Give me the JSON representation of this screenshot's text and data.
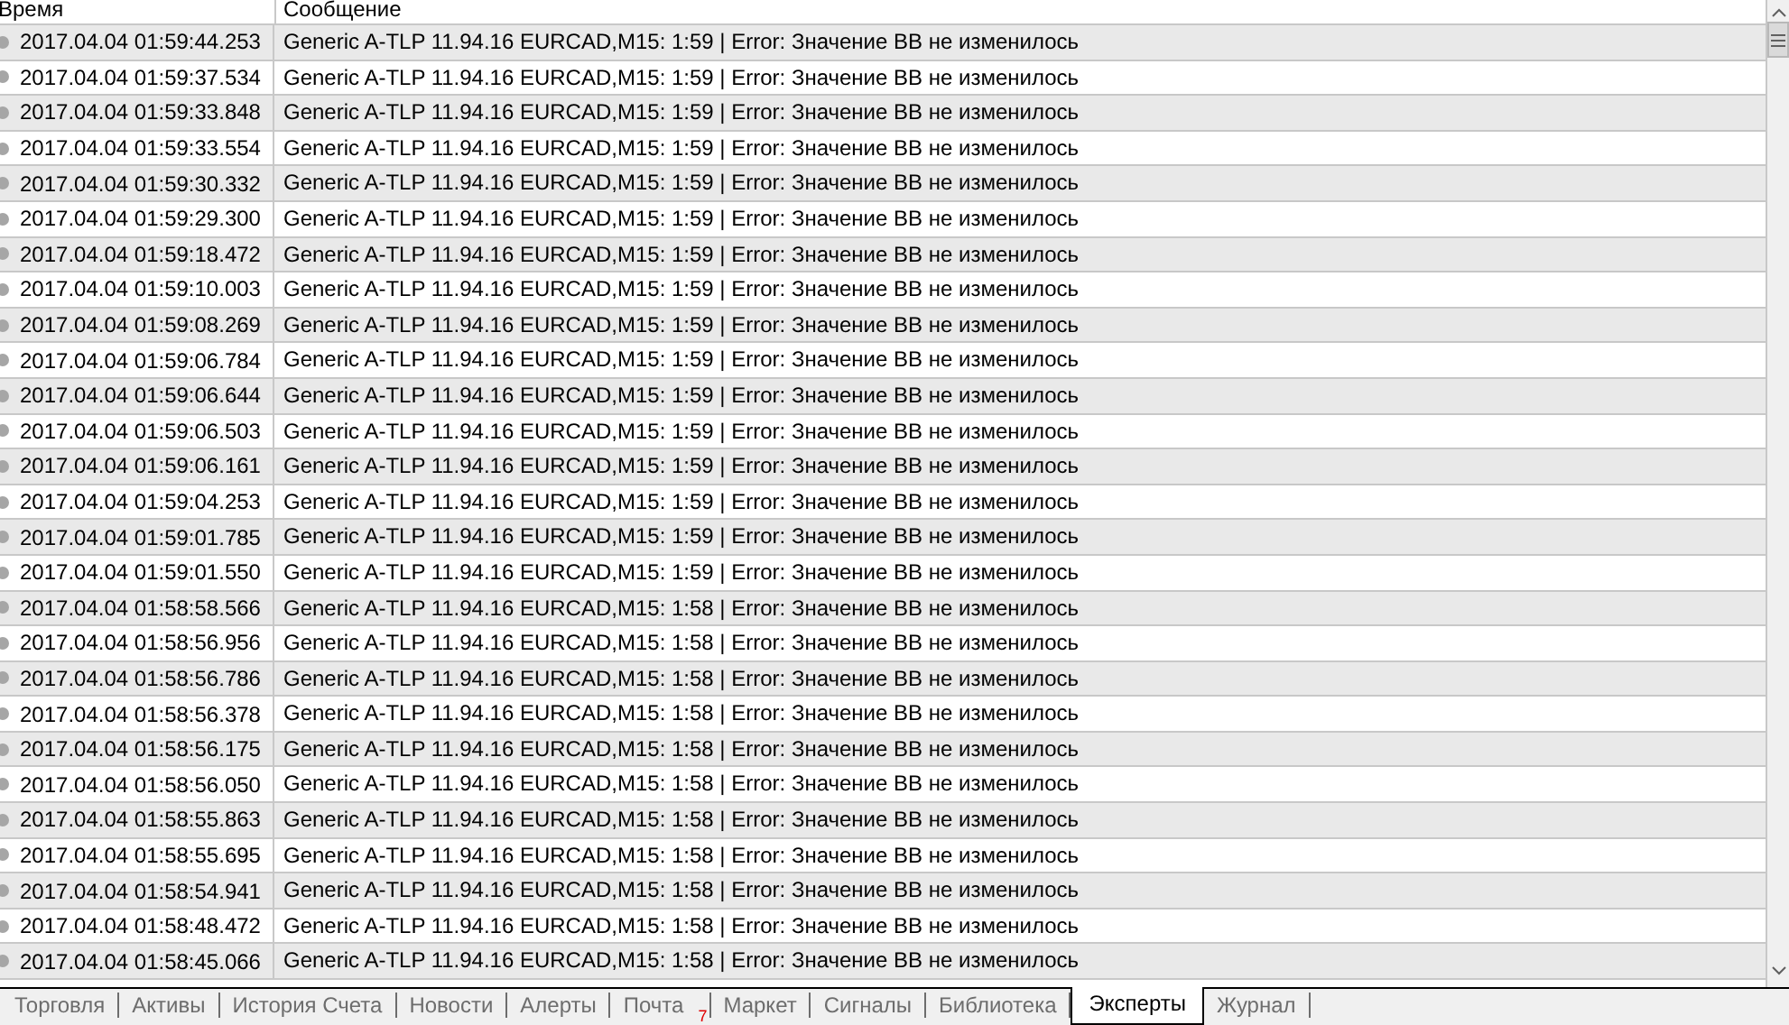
{
  "columns": [
    {
      "label": "Время"
    },
    {
      "label": "Сообщение"
    }
  ],
  "rows": [
    {
      "time": "2017.04.04 01:59:44.253",
      "message": "Generic A-TLP 11.94.16 EURCAD,M15: 1:59 | Error: Значение BB не изменилось"
    },
    {
      "time": "2017.04.04 01:59:37.534",
      "message": "Generic A-TLP 11.94.16 EURCAD,M15: 1:59 | Error: Значение BB не изменилось"
    },
    {
      "time": "2017.04.04 01:59:33.848",
      "message": "Generic A-TLP 11.94.16 EURCAD,M15: 1:59 | Error: Значение BB не изменилось"
    },
    {
      "time": "2017.04.04 01:59:33.554",
      "message": "Generic A-TLP 11.94.16 EURCAD,M15: 1:59 | Error: Значение BB не изменилось"
    },
    {
      "time": "2017.04.04 01:59:30.332",
      "message": "Generic A-TLP 11.94.16 EURCAD,M15: 1:59 | Error: Значение BB не изменилось"
    },
    {
      "time": "2017.04.04 01:59:29.300",
      "message": "Generic A-TLP 11.94.16 EURCAD,M15: 1:59 | Error: Значение BB не изменилось"
    },
    {
      "time": "2017.04.04 01:59:18.472",
      "message": "Generic A-TLP 11.94.16 EURCAD,M15: 1:59 | Error: Значение BB не изменилось"
    },
    {
      "time": "2017.04.04 01:59:10.003",
      "message": "Generic A-TLP 11.94.16 EURCAD,M15: 1:59 | Error: Значение BB не изменилось"
    },
    {
      "time": "2017.04.04 01:59:08.269",
      "message": "Generic A-TLP 11.94.16 EURCAD,M15: 1:59 | Error: Значение BB не изменилось"
    },
    {
      "time": "2017.04.04 01:59:06.784",
      "message": "Generic A-TLP 11.94.16 EURCAD,M15: 1:59 | Error: Значение BB не изменилось"
    },
    {
      "time": "2017.04.04 01:59:06.644",
      "message": "Generic A-TLP 11.94.16 EURCAD,M15: 1:59 | Error: Значение BB не изменилось"
    },
    {
      "time": "2017.04.04 01:59:06.503",
      "message": "Generic A-TLP 11.94.16 EURCAD,M15: 1:59 | Error: Значение BB не изменилось"
    },
    {
      "time": "2017.04.04 01:59:06.161",
      "message": "Generic A-TLP 11.94.16 EURCAD,M15: 1:59 | Error: Значение BB не изменилось"
    },
    {
      "time": "2017.04.04 01:59:04.253",
      "message": "Generic A-TLP 11.94.16 EURCAD,M15: 1:59 | Error: Значение BB не изменилось"
    },
    {
      "time": "2017.04.04 01:59:01.785",
      "message": "Generic A-TLP 11.94.16 EURCAD,M15: 1:59 | Error: Значение BB не изменилось"
    },
    {
      "time": "2017.04.04 01:59:01.550",
      "message": "Generic A-TLP 11.94.16 EURCAD,M15: 1:59 | Error: Значение BB не изменилось"
    },
    {
      "time": "2017.04.04 01:58:58.566",
      "message": "Generic A-TLP 11.94.16 EURCAD,M15: 1:58 | Error: Значение BB не изменилось"
    },
    {
      "time": "2017.04.04 01:58:56.956",
      "message": "Generic A-TLP 11.94.16 EURCAD,M15: 1:58 | Error: Значение BB не изменилось"
    },
    {
      "time": "2017.04.04 01:58:56.786",
      "message": "Generic A-TLP 11.94.16 EURCAD,M15: 1:58 | Error: Значение BB не изменилось"
    },
    {
      "time": "2017.04.04 01:58:56.378",
      "message": "Generic A-TLP 11.94.16 EURCAD,M15: 1:58 | Error: Значение BB не изменилось"
    },
    {
      "time": "2017.04.04 01:58:56.175",
      "message": "Generic A-TLP 11.94.16 EURCAD,M15: 1:58 | Error: Значение BB не изменилось"
    },
    {
      "time": "2017.04.04 01:58:56.050",
      "message": "Generic A-TLP 11.94.16 EURCAD,M15: 1:58 | Error: Значение BB не изменилось"
    },
    {
      "time": "2017.04.04 01:58:55.863",
      "message": "Generic A-TLP 11.94.16 EURCAD,M15: 1:58 | Error: Значение BB не изменилось"
    },
    {
      "time": "2017.04.04 01:58:55.695",
      "message": "Generic A-TLP 11.94.16 EURCAD,M15: 1:58 | Error: Значение BB не изменилось"
    },
    {
      "time": "2017.04.04 01:58:54.941",
      "message": "Generic A-TLP 11.94.16 EURCAD,M15: 1:58 | Error: Значение BB не изменилось"
    },
    {
      "time": "2017.04.04 01:58:48.472",
      "message": "Generic A-TLP 11.94.16 EURCAD,M15: 1:58 | Error: Значение BB не изменилось"
    },
    {
      "time": "2017.04.04 01:58:45.066",
      "message": "Generic A-TLP 11.94.16 EURCAD,M15: 1:58 | Error: Значение BB не изменилось"
    }
  ],
  "tabs": [
    {
      "label": "Торговля",
      "selected": false
    },
    {
      "label": "Активы",
      "selected": false
    },
    {
      "label": "История Счета",
      "selected": false
    },
    {
      "label": "Новости",
      "selected": false
    },
    {
      "label": "Алерты",
      "selected": false
    },
    {
      "label": "Почта",
      "selected": false,
      "badge": "7"
    },
    {
      "label": "Маркет",
      "selected": false
    },
    {
      "label": "Сигналы",
      "selected": false
    },
    {
      "label": "Библиотека",
      "selected": false
    },
    {
      "label": "Эксперты",
      "selected": true
    },
    {
      "label": "Журнал",
      "selected": false
    }
  ]
}
